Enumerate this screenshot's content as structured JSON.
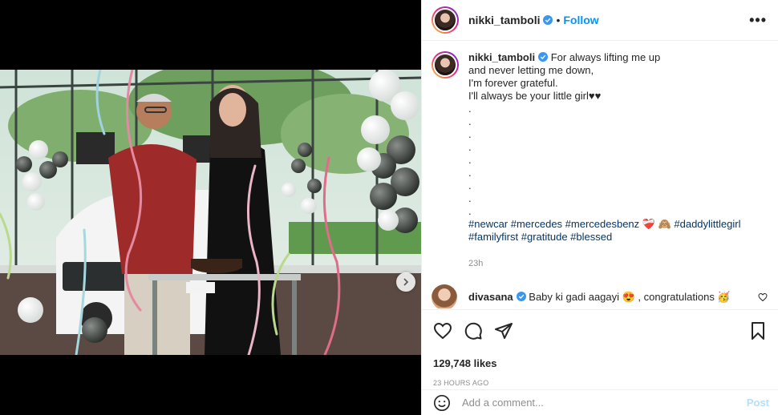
{
  "post": {
    "username": "nikki_tamboli",
    "follow_label": "Follow",
    "more_label": "•••",
    "separator": "•"
  },
  "caption": {
    "username": "nikki_tamboli",
    "lines": [
      "For always lifting me up",
      "and never letting me down,",
      "I'm forever grateful.",
      "I'll always be your little girl♥♥",
      ".",
      ".",
      ".",
      ".",
      ".",
      ".",
      ".",
      ".",
      "."
    ],
    "hashtags_line1": "#newcar #mercedes #mercedesbenz ❤️‍🩹 🙈 #daddylittlegirl",
    "hashtags_line2": "#familyfirst #gratitude #blessed",
    "time": "23h"
  },
  "comment": {
    "username": "divasana",
    "text": "Baby ki gadi aagayi 😍 , congratulations 🥳"
  },
  "engagement": {
    "likes": "129,748 likes",
    "posted": "23 HOURS AGO"
  },
  "add_comment": {
    "placeholder": "Add a comment...",
    "post_label": "Post"
  },
  "carousel": {
    "total": 8,
    "active": 0
  },
  "colors": {
    "accent": "#0095f6",
    "verified": "#3897f0",
    "hashtag": "#00376b",
    "muted": "#8e8e8e"
  }
}
